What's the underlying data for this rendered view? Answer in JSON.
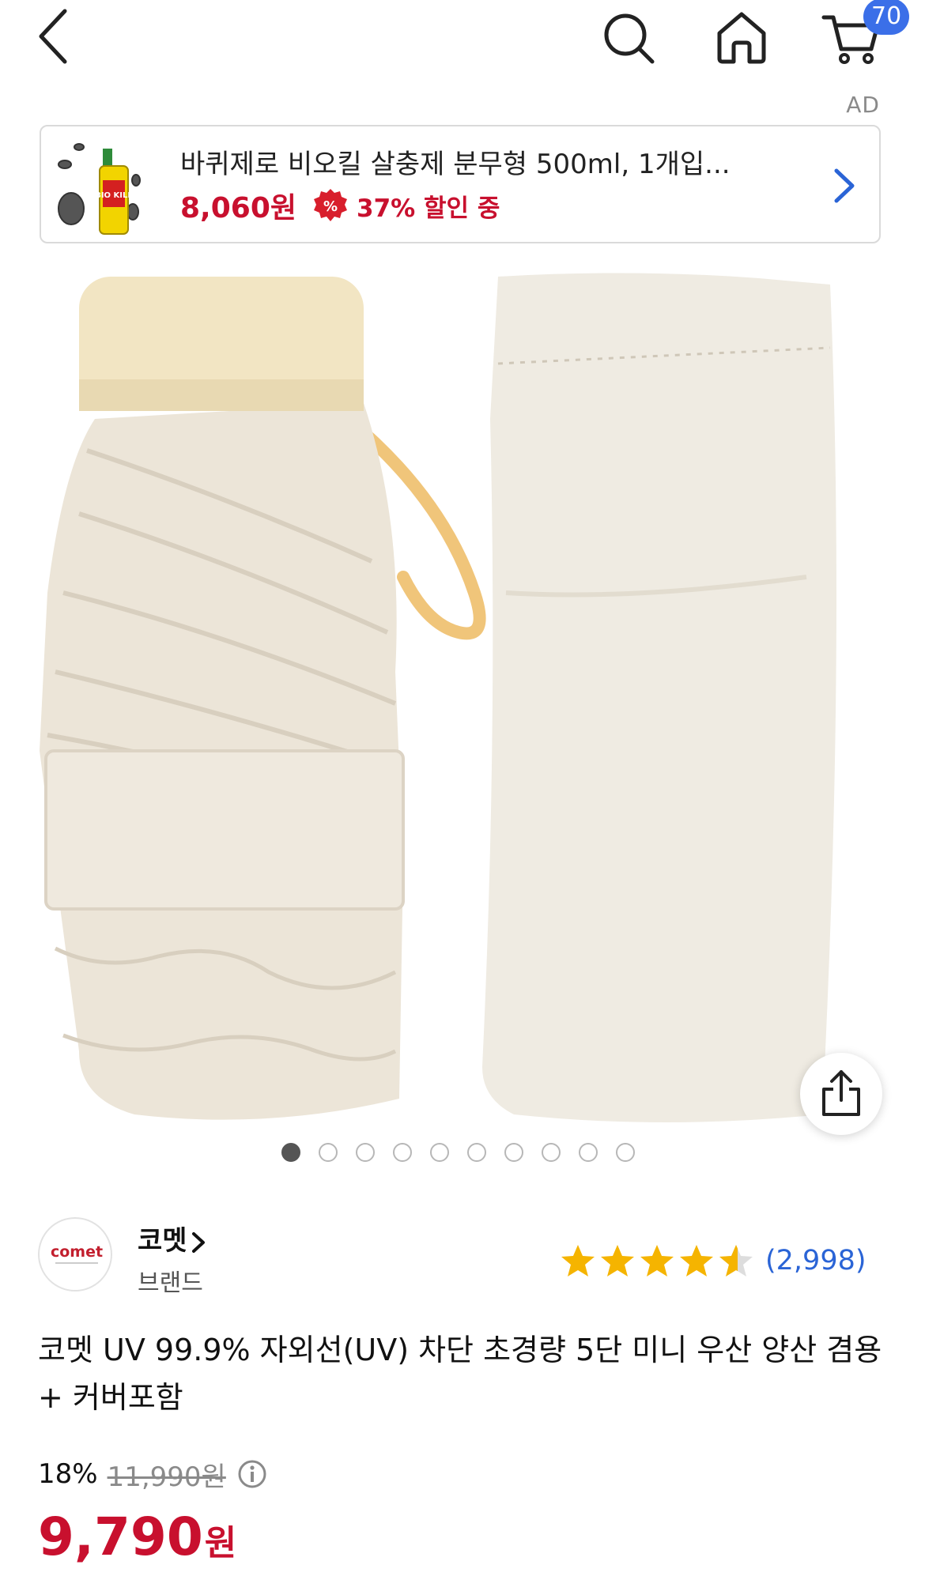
{
  "nav": {
    "cart_count": "70"
  },
  "ad": {
    "label": "AD",
    "title": "바퀴제로 비오킬 살충제 분무형 500ml, 1개입...",
    "price": "8,060원",
    "discount": "37% 할인 중",
    "thumb_text": "BIO KILL"
  },
  "carousel": {
    "total": 10,
    "active_index": 0
  },
  "brand": {
    "logo_text": "comet",
    "name": "코멧",
    "subtitle": "브랜드"
  },
  "rating": {
    "stars": 4.5,
    "count": "(2,998)"
  },
  "product": {
    "title": "코멧 UV 99.9% 자외선(UV) 차단 초경량 5단 미니 우산 양산 겸용 + 커버포함",
    "discount_rate": "18%",
    "original_price": "11,990원",
    "final_price": "9,790",
    "final_unit": "원"
  },
  "colors": {
    "accent_red": "#c8102e",
    "link_blue": "#2a64d6",
    "badge_blue": "#3b6fe8",
    "star_yellow": "#f5b400"
  }
}
